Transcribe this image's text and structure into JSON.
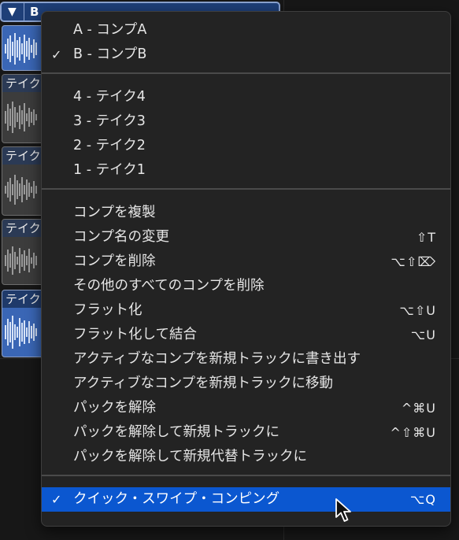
{
  "comp_header": {
    "triangle": "▼",
    "letter": "B"
  },
  "take_lanes": [
    {
      "label": "テイク"
    },
    {
      "label": "テイク"
    },
    {
      "label": "テイク"
    },
    {
      "label": "テイク"
    }
  ],
  "menu": {
    "comps": [
      {
        "label": "A - コンプA",
        "checked": false,
        "check": ""
      },
      {
        "label": "B - コンプB",
        "checked": true,
        "check": "✓"
      }
    ],
    "takes": [
      {
        "label": "4 - テイク4"
      },
      {
        "label": "3 - テイク3"
      },
      {
        "label": "2 - テイク2"
      },
      {
        "label": "1 - テイク1"
      }
    ],
    "actions": [
      {
        "label": "コンプを複製",
        "shortcut": ""
      },
      {
        "label": "コンプ名の変更",
        "shortcut": "⇧T"
      },
      {
        "label": "コンプを削除",
        "shortcut": "⌥⇧⌦"
      },
      {
        "label": "その他のすべてのコンプを削除",
        "shortcut": ""
      },
      {
        "label": "フラット化",
        "shortcut": "⌥⇧U"
      },
      {
        "label": "フラット化して結合",
        "shortcut": "⌥U"
      },
      {
        "label": "アクティブなコンプを新規トラックに書き出す",
        "shortcut": ""
      },
      {
        "label": "アクティブなコンプを新規トラックに移動",
        "shortcut": ""
      },
      {
        "label": "パックを解除",
        "shortcut": "^⌘U"
      },
      {
        "label": "パックを解除して新規トラックに",
        "shortcut": "^⇧⌘U"
      },
      {
        "label": "パックを解除して新規代替トラックに",
        "shortcut": ""
      }
    ],
    "quick_swipe": {
      "label": "クイック・スワイプ・コンピング",
      "check": "✓",
      "shortcut": "⌥Q"
    }
  },
  "colors": {
    "highlight": "#0b57d0",
    "menu_bg": "#232323",
    "text": "#e6e6e6"
  }
}
